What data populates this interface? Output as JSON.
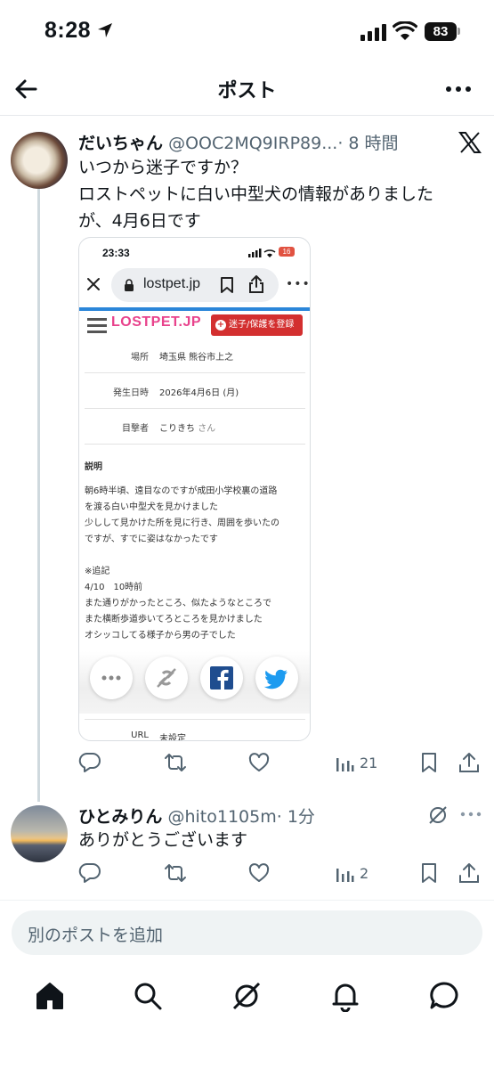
{
  "status_bar": {
    "time": "8:28",
    "battery": "83"
  },
  "header": {
    "title": "ポスト"
  },
  "post": {
    "name": "だいちゃん",
    "handle": "@OOC2MQ9IRP89...",
    "time": "· 8 時間",
    "text_lines": [
      "いつから迷子ですか？",
      "ロストペットに白い中型犬の情報がありました",
      "が、4月6日です"
    ],
    "stats": {
      "views": "21"
    }
  },
  "embed": {
    "time": "23:33",
    "battery": "16",
    "url": "lostpet.jp",
    "logo": "LOSTPET.JP",
    "register_label": "迷子/保護を登録",
    "rows": [
      {
        "label": "場所",
        "value": "埼玉県 熊谷市上之"
      },
      {
        "label": "発生日時",
        "value": "2026年4月6日 (月)"
      },
      {
        "label": "目撃者",
        "value": "こりきち",
        "suffix": "さん"
      }
    ],
    "description_title": "説明",
    "description": "朝6時半頃、遠目なのですが成田小学校裏の道路\nを渡る白い中型犬を見かけました\n少しして見かけた所を見に行き、周囲を歩いたの\nですが、すでに姿はなかったです",
    "note": "※追記\n4/10　10時前\nまた通りがかったところ、似たようなところで\nまた横断歩道歩いてろところを見かけました\nオシッコしてる様子から男の子でした",
    "url_label": "URL",
    "url_value": "未設定"
  },
  "reply": {
    "name": "ひとみりん",
    "handle": "@hito1105m",
    "time": "· 1分",
    "text": "ありがとうございます",
    "stats": {
      "views": "2"
    }
  },
  "compose": {
    "placeholder": "別のポストを追加"
  },
  "colors": {
    "text": "#0f1419",
    "secondary": "#536471",
    "thread": "#cfd9de",
    "register": "#d32f2f",
    "logo": "#e8428c"
  }
}
